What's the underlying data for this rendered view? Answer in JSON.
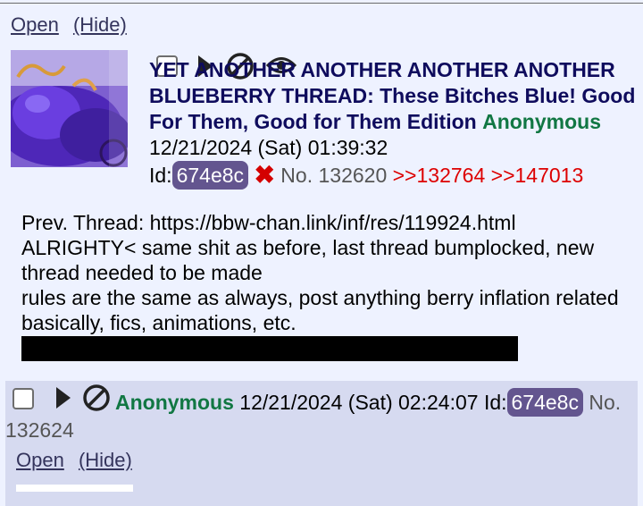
{
  "thread": {
    "open_label": "Open",
    "hide_label": "(Hide)"
  },
  "op": {
    "subject": "YET ANOTHER ANOTHER ANOTHER ANOTHER BLUEBERRY THREAD: These Bitches Blue! Good For Them, Good for Them Edition",
    "name": "Anonymous",
    "datetime": "12/21/2024 (Sat) 01:39:32",
    "id_label": "Id:",
    "id": "674e8c",
    "delete_glyph": "✖",
    "no_label": "No.",
    "post_number": "132620",
    "backlinks": [
      ">>132764",
      ">>147013"
    ],
    "body": [
      "Prev. Thread: https://bbw-chan.link/inf/res/119924.html",
      "ALRIGHTY< same shit as before, last thread bumplocked, new thread needed to be made",
      "rules are the same as always, post anything berry inflation related basically, fics, animations, etc."
    ]
  },
  "reply": {
    "name": "Anonymous",
    "datetime": "12/21/2024 (Sat) 02:24:07",
    "id_label": "Id:",
    "id": "674e8c",
    "no_label": "No.",
    "post_number": "132624",
    "open_label": "Open",
    "hide_label": "(Hide)"
  },
  "colors": {
    "background": "#eef2ff",
    "reply_background": "#d6daf0",
    "subject": "#0f0c5d",
    "name": "#117743",
    "id_badge": "#63558f",
    "quotelink": "#dd0000",
    "link": "#34345c"
  },
  "icons": [
    "checkbox",
    "play-arrow-icon",
    "block-icon",
    "eye-icon",
    "delete-x-icon",
    "thumbnail-image"
  ]
}
